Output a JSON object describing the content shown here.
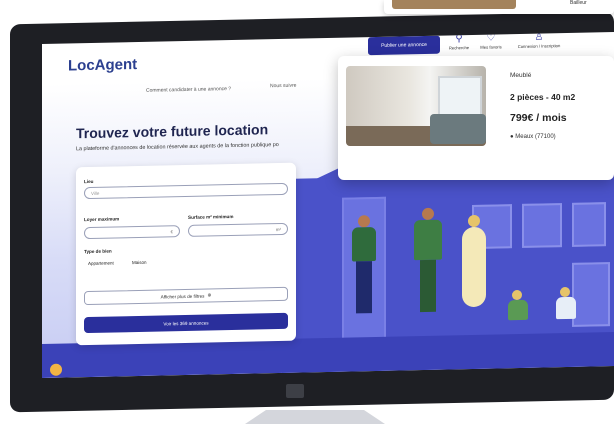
{
  "header": {
    "logo": "LocAgent",
    "publish_button": "Publier une annonce",
    "nav": [
      {
        "label": "Comment candidater à une annonce ?"
      },
      {
        "label": "Nous suivre"
      }
    ],
    "icons": [
      {
        "icon": "search-icon",
        "label": "Recherche"
      },
      {
        "icon": "heart-icon",
        "label": "Mes favoris"
      },
      {
        "icon": "user-icon",
        "label": "Connexion / Inscription"
      }
    ]
  },
  "hero": {
    "title": "Trouvez votre future location",
    "subtitle": "La plateforme d'annonces de location réservée aux agents de la fonction publique po"
  },
  "search": {
    "where_label": "Lieu",
    "where_placeholder": "Ville",
    "rent_label": "Loyer maximum",
    "rent_unit": "€",
    "surface_label": "Surface m² minimum",
    "surface_unit": "m²",
    "type_label": "Type de bien",
    "types": [
      "Appartement",
      "Maison"
    ],
    "filters_button": "Afficher plus de filtres",
    "see_button": "Voir les 369 annonces"
  },
  "listing": {
    "type": "Meublé",
    "rooms": "2 pièces - 40 m2",
    "price": "799€ / mois",
    "location": "Meaux (77100)"
  },
  "top_banner": {
    "text": "Bailleur"
  }
}
